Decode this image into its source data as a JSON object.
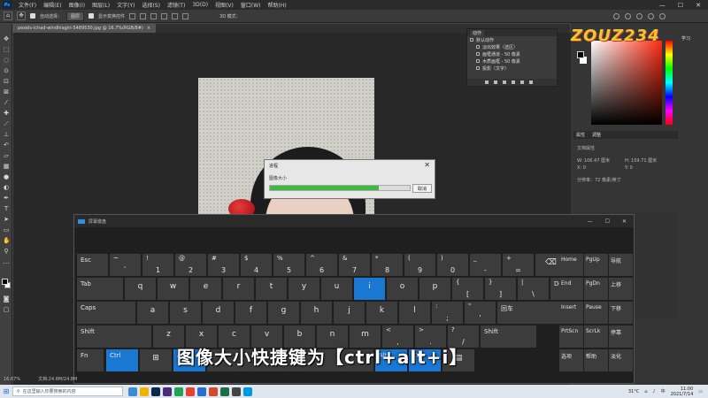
{
  "menubar": {
    "logo": "Ps",
    "items": [
      "文件(F)",
      "编辑(E)",
      "图像(I)",
      "图层(L)",
      "文字(Y)",
      "选择(S)",
      "滤镜(T)",
      "3D(D)",
      "视图(V)",
      "窗口(W)",
      "帮助(H)"
    ],
    "win_min": "—",
    "win_max": "☐",
    "win_close": "✕"
  },
  "optbar": {
    "auto_select": "自动选择：",
    "select_target": "图层",
    "show_transform": "显示变换控件",
    "mode3d": "3D 模式："
  },
  "tab": {
    "label": "pexels-ichad-windhiagiri-5489530.jpg @ 16.7%(RGB/8#)",
    "close": "×"
  },
  "actions": {
    "tab": "动作",
    "rows": [
      "默认动作",
      "淡出效果（选区）",
      "画框通道 - 50 像素",
      "木质画框 - 50 像素",
      "投影（文字）"
    ]
  },
  "learn": "学习",
  "properties": {
    "tab1": "属性",
    "tab2": "调整",
    "doc_props": "文档属性",
    "w": "W:  106.47 厘米",
    "h": "H:  159.71 厘米",
    "x": "X:  0",
    "y": "Y:  0",
    "res": "分辨率：72 像素/英寸"
  },
  "watermark": "ZOUZ234",
  "dialog": {
    "title": "进程",
    "close": "✕",
    "label": "图像大小",
    "progress": 0.78,
    "cancel": "取消"
  },
  "osk": {
    "title": "屏幕键盘",
    "min": "—",
    "max": "☐",
    "close": "✕",
    "side_keys": [
      "Home",
      "PgUp",
      "导航",
      "End",
      "PgDn",
      "上移",
      "Insert",
      "Pause",
      "下移",
      "PrtScn",
      "ScrLk",
      "停靠",
      "选项",
      "帮助",
      "淡化"
    ]
  },
  "keys": {
    "esc": "Esc",
    "tab": "Tab",
    "caps": "Caps",
    "shift": "Shift",
    "shift_r": "Shift",
    "fn": "Fn",
    "ctrl": "Ctrl",
    "alt": "Alt",
    "del": "Del",
    "enter": "回车",
    "backspace": "⌫",
    "win": "⊞",
    "menu": "▤",
    "n1": [
      "~",
      "`"
    ],
    "n2": [
      "!",
      "1"
    ],
    "n3": [
      "@",
      "2"
    ],
    "n4": [
      "#",
      "3"
    ],
    "n5": [
      "$",
      "4"
    ],
    "n6": [
      "%",
      "5"
    ],
    "n7": [
      "^",
      "6"
    ],
    "n8": [
      "&",
      "7"
    ],
    "n9": [
      "*",
      "8"
    ],
    "n10": [
      "(",
      "9"
    ],
    "n11": [
      ")",
      "0"
    ],
    "n12": [
      "_",
      "-"
    ],
    "n13": [
      "+",
      "="
    ],
    "q": "q",
    "w": "w",
    "e": "e",
    "r": "r",
    "t": "t",
    "y": "y",
    "u": "u",
    "i": "i",
    "o": "o",
    "p": "p",
    "lb": [
      "{",
      "["
    ],
    "rb": [
      "}",
      "]"
    ],
    "bs": [
      "|",
      "\\"
    ],
    "a": "a",
    "s": "s",
    "d": "d",
    "f": "f",
    "g": "g",
    "h": "h",
    "j": "j",
    "k": "k",
    "l": "l",
    "sc": [
      ":",
      ";"
    ],
    "qt": [
      "\"",
      "'"
    ],
    "z": "z",
    "x": "x",
    "c": "c",
    "v": "v",
    "b": "b",
    "n": "n",
    "m": "m",
    "cm": [
      "<",
      ","
    ],
    "pd": [
      ">",
      "."
    ],
    "sl": [
      "?",
      "/"
    ]
  },
  "caption": "图像大小快捷键为【ctrl+alt+i】",
  "statusbar": {
    "zoom": "16.67%",
    "doc": "文档:24.8M/24.8M"
  },
  "taskbar": {
    "search": "在这里输入你要搜索的内容",
    "temp": "31°C",
    "ime": "中",
    "time": "11:00",
    "date": "2021/7/14"
  }
}
